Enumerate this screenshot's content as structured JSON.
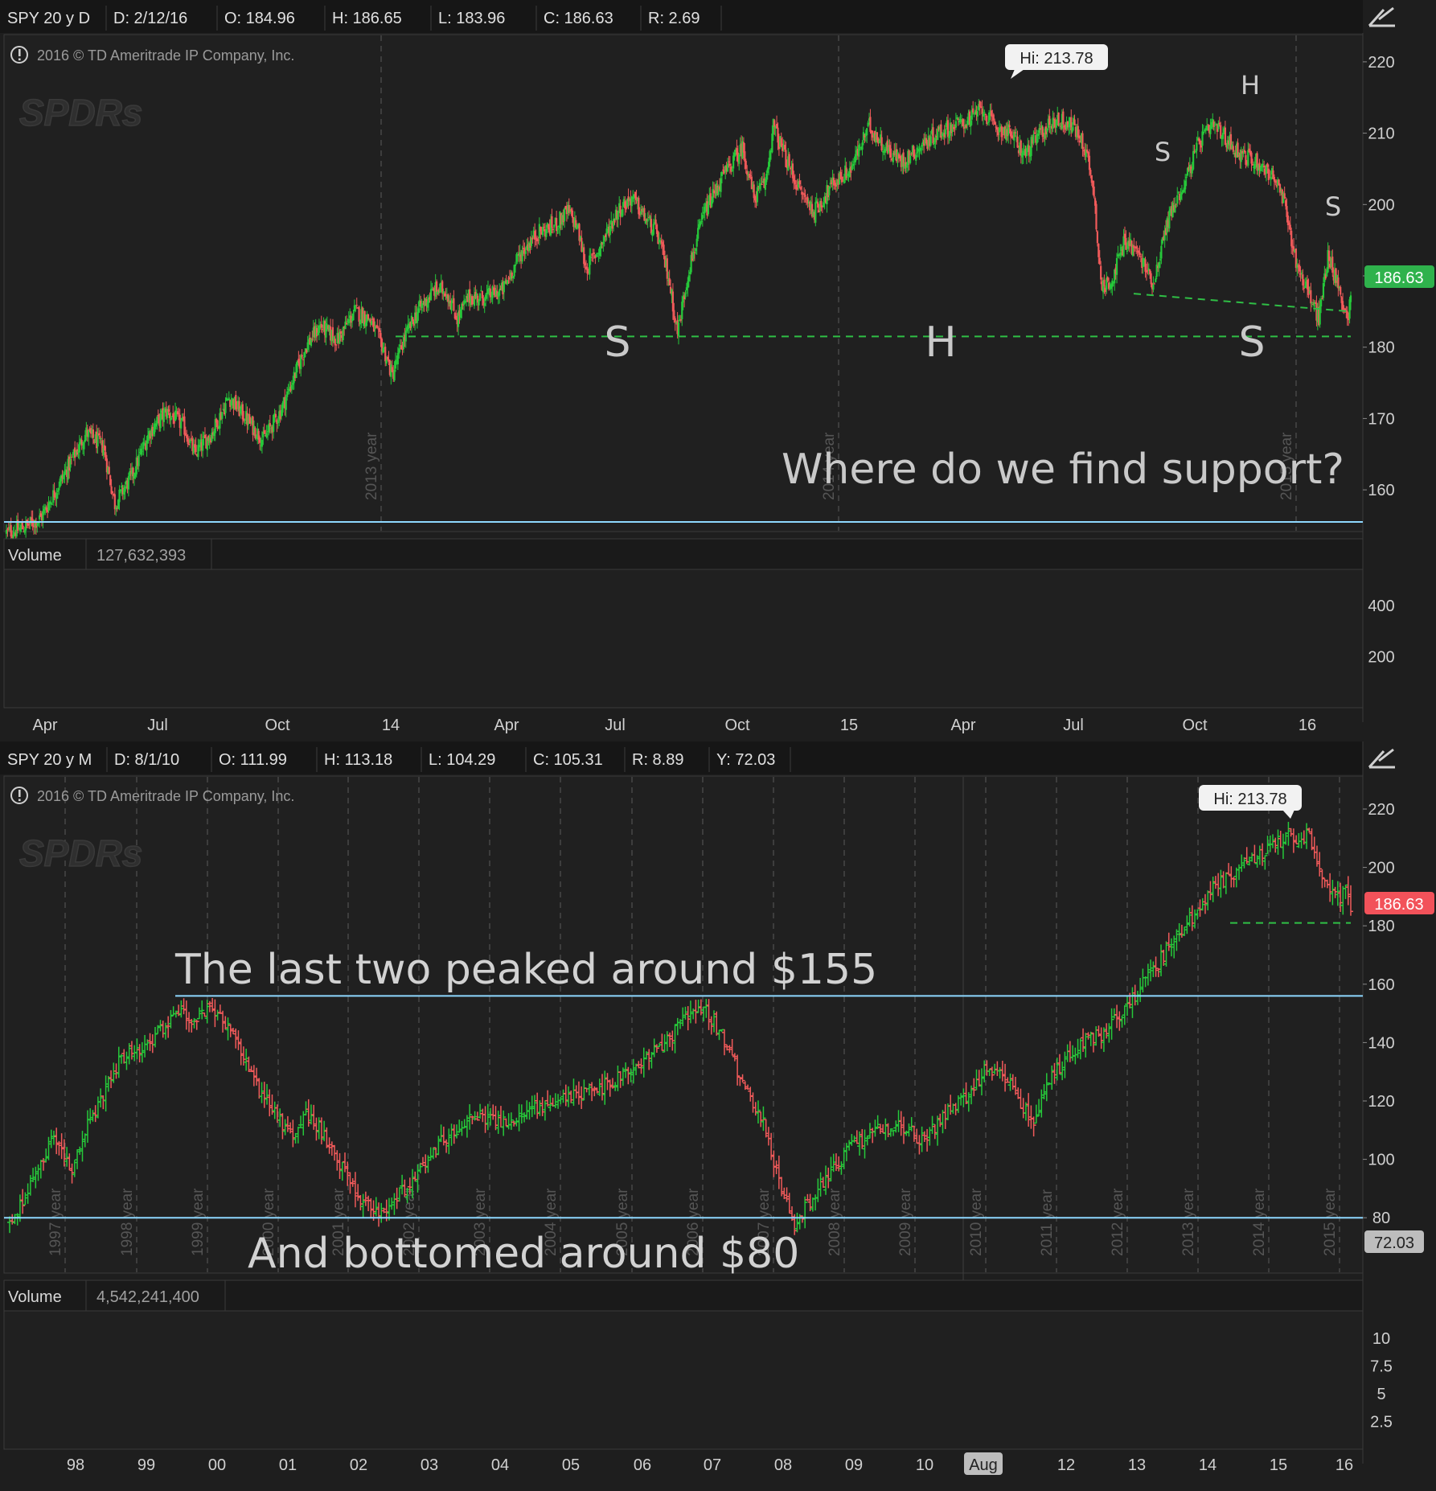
{
  "top": {
    "header": [
      {
        "text": "SPY 20 y D",
        "w": 132
      },
      {
        "text": "D:  2/12/16",
        "w": 138
      },
      {
        "text": "O:  184.96",
        "w": 134
      },
      {
        "text": "H:  186.65",
        "w": 132
      },
      {
        "text": "L:  183.96",
        "w": 131
      },
      {
        "text": "C:  186.63",
        "w": 130
      },
      {
        "text": "R:  2.69",
        "w": 100
      }
    ],
    "copyright": "2016 © TD Ameritrade IP Company, Inc.",
    "watermark": "SPDRs",
    "hi_label": "Hi: 213.78",
    "last_price": "186.63",
    "volume_label": "Volume",
    "volume_value": "127,632,393",
    "annotations": {
      "question": "Where do we find support?",
      "hs_big": [
        "S",
        "H",
        "S"
      ],
      "hs_small": [
        "S",
        "H",
        "S"
      ]
    },
    "year_markers": [
      "2013 year",
      "2014 year",
      "2015 year"
    ],
    "chart_data": {
      "type": "candlestick",
      "title": "SPY 20 y D",
      "yticks": [
        160,
        170,
        180,
        190,
        200,
        210,
        220
      ],
      "ylim": [
        152.5,
        221
      ],
      "xticks": [
        "Apr",
        "Jul",
        "Oct",
        "14",
        "Apr",
        "Jul",
        "Oct",
        "15",
        "Apr",
        "Jul",
        "Oct",
        "16"
      ],
      "x_range": [
        "2013-02",
        "2016-02-12"
      ],
      "waypoints": [
        [
          0,
          154
        ],
        [
          12,
          154.5
        ],
        [
          30,
          156
        ],
        [
          50,
          162
        ],
        [
          70,
          168
        ],
        [
          85,
          166
        ],
        [
          95,
          158
        ],
        [
          110,
          162
        ],
        [
          125,
          168
        ],
        [
          140,
          171
        ],
        [
          155,
          169
        ],
        [
          165,
          165
        ],
        [
          180,
          168
        ],
        [
          195,
          173
        ],
        [
          210,
          170
        ],
        [
          225,
          167
        ],
        [
          240,
          171
        ],
        [
          250,
          175
        ],
        [
          262,
          180
        ],
        [
          275,
          183
        ],
        [
          290,
          181
        ],
        [
          305,
          185
        ],
        [
          318,
          184
        ],
        [
          330,
          180
        ],
        [
          338,
          176
        ],
        [
          348,
          181
        ],
        [
          360,
          185
        ],
        [
          375,
          188
        ],
        [
          385,
          188
        ],
        [
          395,
          184
        ],
        [
          405,
          187
        ],
        [
          420,
          187
        ],
        [
          435,
          188
        ],
        [
          450,
          193
        ],
        [
          465,
          196
        ],
        [
          480,
          197
        ],
        [
          492,
          199
        ],
        [
          500,
          197
        ],
        [
          508,
          191
        ],
        [
          520,
          194
        ],
        [
          535,
          199
        ],
        [
          548,
          201
        ],
        [
          560,
          198
        ],
        [
          570,
          196
        ],
        [
          580,
          190
        ],
        [
          588,
          182
        ],
        [
          598,
          191
        ],
        [
          612,
          199
        ],
        [
          628,
          204
        ],
        [
          645,
          208
        ],
        [
          655,
          201
        ],
        [
          665,
          203
        ],
        [
          672,
          211
        ],
        [
          684,
          206
        ],
        [
          695,
          202
        ],
        [
          708,
          199
        ],
        [
          725,
          203
        ],
        [
          740,
          205
        ],
        [
          756,
          211
        ],
        [
          770,
          208
        ],
        [
          785,
          206
        ],
        [
          800,
          208
        ],
        [
          815,
          210
        ],
        [
          830,
          211
        ],
        [
          845,
          212
        ],
        [
          855,
          213.5
        ],
        [
          865,
          211
        ],
        [
          880,
          210
        ],
        [
          892,
          207
        ],
        [
          906,
          210
        ],
        [
          920,
          212
        ],
        [
          935,
          211
        ],
        [
          945,
          208
        ],
        [
          952,
          203
        ],
        [
          960,
          188
        ],
        [
          970,
          190
        ],
        [
          980,
          195
        ],
        [
          992,
          193
        ],
        [
          1005,
          189
        ],
        [
          1018,
          198
        ],
        [
          1032,
          203
        ],
        [
          1046,
          209
        ],
        [
          1058,
          211
        ],
        [
          1070,
          209
        ],
        [
          1082,
          207
        ],
        [
          1095,
          206
        ],
        [
          1110,
          204
        ],
        [
          1120,
          200
        ],
        [
          1130,
          192
        ],
        [
          1140,
          188
        ],
        [
          1150,
          184
        ],
        [
          1158,
          193
        ],
        [
          1168,
          188
        ],
        [
          1175,
          184
        ],
        [
          1178,
          186.6
        ]
      ],
      "support_line": 181.5,
      "neckline": {
        "from": 187.5,
        "to": 185
      },
      "blue_line": 155.5,
      "high": 213.78,
      "close": 186.63,
      "volume": {
        "yticks": [
          200,
          400
        ],
        "unit": "millions"
      }
    },
    "time_labels": [
      "Apr",
      "Jul",
      "Oct",
      "14",
      "Apr",
      "Jul",
      "Oct",
      "15",
      "Apr",
      "Jul",
      "Oct",
      "16"
    ]
  },
  "bottom": {
    "header": [
      {
        "text": "SPY 20 y M",
        "w": 133
      },
      {
        "text": "D:  8/1/10",
        "w": 130
      },
      {
        "text": "O:  111.99",
        "w": 131
      },
      {
        "text": "H:  113.18",
        "w": 130
      },
      {
        "text": "L:  104.29",
        "w": 130
      },
      {
        "text": "C:  105.31",
        "w": 123
      },
      {
        "text": "R:  8.89",
        "w": 105
      },
      {
        "text": "Y:  72.03",
        "w": 101
      }
    ],
    "copyright": "2016 © TD Ameritrade IP Company, Inc.",
    "watermark": "SPDRs",
    "hi_label": "Hi: 213.78",
    "last_price": "186.63",
    "y_badge": "72.03",
    "volume_label": "Volume",
    "volume_value": "4,542,241,400",
    "annotations": {
      "peak": "The last two peaked around $155",
      "bottom": "And bottomed around $80"
    },
    "year_markers": [
      "1997 year",
      "1998 year",
      "1999 year",
      "2000 year",
      "2001 year",
      "2002 year",
      "2003 year",
      "2004 year",
      "2005 year",
      "2006 year",
      "2007 year",
      "2008 year",
      "2009 year",
      "2010 year",
      "2011 year",
      "2012 year",
      "2013 year",
      "2014 year",
      "2015 year"
    ],
    "chart_data": {
      "type": "ohlc-bar",
      "title": "SPY 20 y M",
      "yticks": [
        80,
        100,
        120,
        140,
        160,
        180,
        200,
        220
      ],
      "ylim": [
        72,
        224
      ],
      "xticks": [
        "98",
        "99",
        "00",
        "01",
        "02",
        "03",
        "04",
        "05",
        "06",
        "07",
        "08",
        "09",
        "10",
        "Aug",
        "12",
        "13",
        "14",
        "15",
        "16"
      ],
      "waypoints": [
        [
          0,
          79
        ],
        [
          6,
          86
        ],
        [
          12,
          100
        ],
        [
          18,
          108
        ],
        [
          24,
          95
        ],
        [
          30,
          113
        ],
        [
          36,
          122
        ],
        [
          42,
          134
        ],
        [
          50,
          138
        ],
        [
          60,
          145
        ],
        [
          66,
          150
        ],
        [
          70,
          146
        ],
        [
          78,
          152
        ],
        [
          86,
          143
        ],
        [
          92,
          130
        ],
        [
          100,
          118
        ],
        [
          108,
          108
        ],
        [
          114,
          114
        ],
        [
          120,
          110
        ],
        [
          126,
          100
        ],
        [
          132,
          90
        ],
        [
          138,
          84
        ],
        [
          142,
          82
        ],
        [
          150,
          88
        ],
        [
          160,
          100
        ],
        [
          170,
          110
        ],
        [
          180,
          115
        ],
        [
          192,
          112
        ],
        [
          204,
          118
        ],
        [
          216,
          121
        ],
        [
          228,
          125
        ],
        [
          240,
          130
        ],
        [
          252,
          140
        ],
        [
          260,
          148
        ],
        [
          266,
          152
        ],
        [
          270,
          148
        ],
        [
          275,
          141
        ],
        [
          280,
          130
        ],
        [
          285,
          120
        ],
        [
          290,
          112
        ],
        [
          294,
          98
        ],
        [
          298,
          88
        ],
        [
          302,
          78
        ],
        [
          308,
          86
        ],
        [
          316,
          96
        ],
        [
          324,
          105
        ],
        [
          334,
          110
        ],
        [
          344,
          111
        ],
        [
          352,
          106
        ],
        [
          360,
          116
        ],
        [
          368,
          121
        ],
        [
          376,
          132
        ],
        [
          382,
          130
        ],
        [
          388,
          120
        ],
        [
          394,
          114
        ],
        [
          402,
          130
        ],
        [
          410,
          138
        ],
        [
          420,
          143
        ],
        [
          432,
          155
        ],
        [
          444,
          170
        ],
        [
          454,
          182
        ],
        [
          464,
          194
        ],
        [
          474,
          200
        ],
        [
          482,
          205
        ],
        [
          490,
          210
        ],
        [
          500,
          211
        ],
        [
          504,
          200
        ],
        [
          508,
          194
        ],
        [
          512,
          188
        ],
        [
          514,
          193
        ],
        [
          516,
          186.6
        ]
      ],
      "peak_line": 156,
      "bottom_line": 80,
      "top_dashed": 181,
      "high": 213.78,
      "close": 186.63,
      "volume": {
        "yticks": [
          2.5,
          5,
          7.5,
          10
        ],
        "unit": "billions"
      }
    },
    "time_labels": [
      "98",
      "99",
      "00",
      "01",
      "02",
      "03",
      "04",
      "05",
      "06",
      "07",
      "08",
      "09",
      "10",
      "Aug",
      "12",
      "13",
      "14",
      "15",
      "16"
    ]
  }
}
